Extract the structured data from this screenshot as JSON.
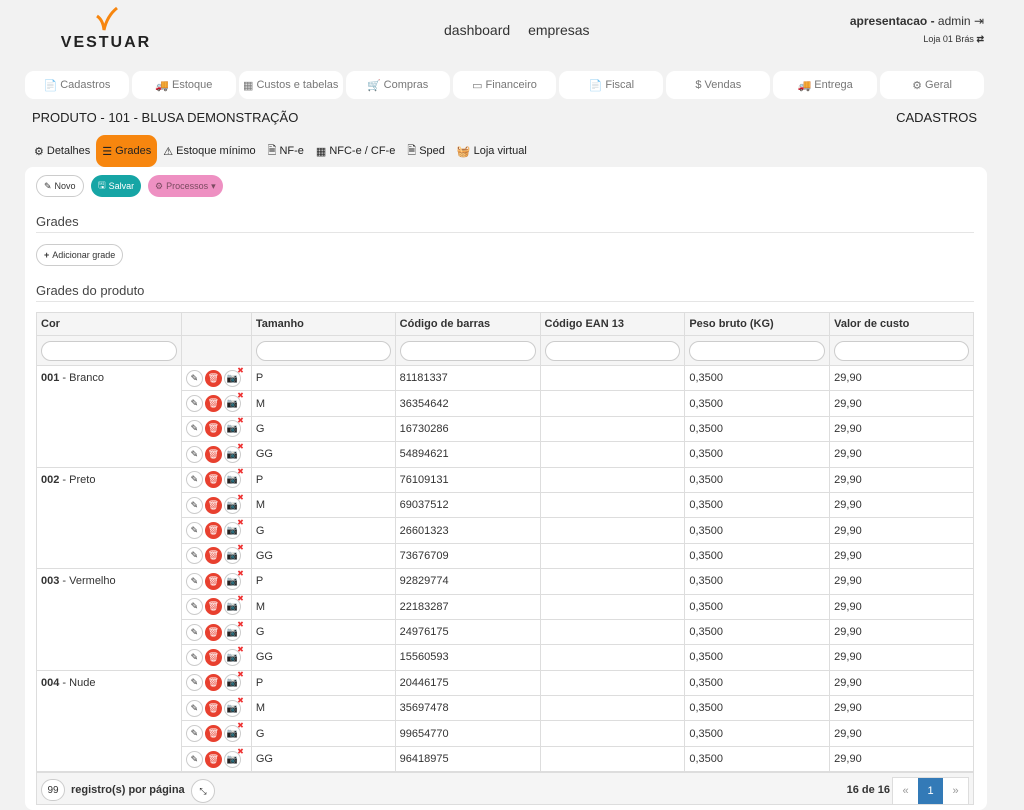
{
  "brand": {
    "name": "VESTUAR",
    "accent": "#f7860f"
  },
  "topnav": [
    "dashboard",
    "empresas"
  ],
  "user": {
    "company": "apresentacao",
    "sep": " - ",
    "name": "admin",
    "store": "Loja 01 Brás"
  },
  "menu": [
    {
      "label": "Cadastros",
      "icon": "📄"
    },
    {
      "label": "Estoque",
      "icon": "🚚"
    },
    {
      "label": "Custos e tabelas",
      "icon": "▦"
    },
    {
      "label": "Compras",
      "icon": "🛒"
    },
    {
      "label": "Financeiro",
      "icon": "▭"
    },
    {
      "label": "Fiscal",
      "icon": "📄"
    },
    {
      "label": "Vendas",
      "icon": "$"
    },
    {
      "label": "Entrega",
      "icon": "🚚"
    },
    {
      "label": "Geral",
      "icon": "⚙"
    }
  ],
  "page": {
    "title": "PRODUTO - 101 - BLUSA DEMONSTRAÇÃO",
    "section": "CADASTROS"
  },
  "tabs": [
    {
      "label": "Detalhes",
      "icon": "⚙"
    },
    {
      "label": "Grades",
      "icon": "☰",
      "active": true
    },
    {
      "label": "Estoque mínimo",
      "icon": "⚠"
    },
    {
      "label": "NF-e",
      "icon": "🗎"
    },
    {
      "label": "NFC-e / CF-e",
      "icon": "▦"
    },
    {
      "label": "Sped",
      "icon": "🗎"
    },
    {
      "label": "Loja virtual",
      "icon": "🧺"
    }
  ],
  "actions": {
    "novo": "Novo",
    "salvar": "Salvar",
    "processos": "Processos"
  },
  "grades_heading": "Grades",
  "add_grade": "Adicionar grade",
  "grades_produto_heading": "Grades do produto",
  "columns": [
    "Cor",
    "",
    "Tamanho",
    "Código de barras",
    "Código EAN 13",
    "Peso bruto (KG)",
    "Valor de custo"
  ],
  "groups": [
    {
      "code": "001",
      "name": "Branco",
      "rows": [
        [
          "P",
          "81181337",
          "",
          "0,3500",
          "29,90"
        ],
        [
          "M",
          "36354642",
          "",
          "0,3500",
          "29,90"
        ],
        [
          "G",
          "16730286",
          "",
          "0,3500",
          "29,90"
        ],
        [
          "GG",
          "54894621",
          "",
          "0,3500",
          "29,90"
        ]
      ]
    },
    {
      "code": "002",
      "name": "Preto",
      "rows": [
        [
          "P",
          "76109131",
          "",
          "0,3500",
          "29,90"
        ],
        [
          "M",
          "69037512",
          "",
          "0,3500",
          "29,90"
        ],
        [
          "G",
          "26601323",
          "",
          "0,3500",
          "29,90"
        ],
        [
          "GG",
          "73676709",
          "",
          "0,3500",
          "29,90"
        ]
      ]
    },
    {
      "code": "003",
      "name": "Vermelho",
      "rows": [
        [
          "P",
          "92829774",
          "",
          "0,3500",
          "29,90"
        ],
        [
          "M",
          "22183287",
          "",
          "0,3500",
          "29,90"
        ],
        [
          "G",
          "24976175",
          "",
          "0,3500",
          "29,90"
        ],
        [
          "GG",
          "15560593",
          "",
          "0,3500",
          "29,90"
        ]
      ]
    },
    {
      "code": "004",
      "name": "Nude",
      "rows": [
        [
          "P",
          "20446175",
          "",
          "0,3500",
          "29,90"
        ],
        [
          "M",
          "35697478",
          "",
          "0,3500",
          "29,90"
        ],
        [
          "G",
          "99654770",
          "",
          "0,3500",
          "29,90"
        ],
        [
          "GG",
          "96418975",
          "",
          "0,3500",
          "29,90"
        ]
      ]
    }
  ],
  "footer": {
    "per_page": "99",
    "per_page_label": "registro(s) por página",
    "count": "16 de 16",
    "prev": "«",
    "page": "1",
    "next": "»"
  }
}
